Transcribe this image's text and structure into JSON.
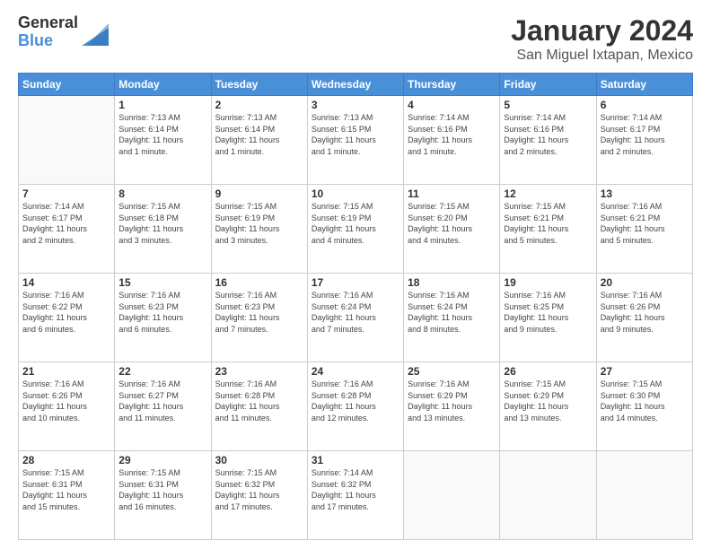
{
  "logo": {
    "general": "General",
    "blue": "Blue"
  },
  "header": {
    "title": "January 2024",
    "subtitle": "San Miguel Ixtapan, Mexico"
  },
  "weekdays": [
    "Sunday",
    "Monday",
    "Tuesday",
    "Wednesday",
    "Thursday",
    "Friday",
    "Saturday"
  ],
  "weeks": [
    [
      {
        "day": "",
        "info": ""
      },
      {
        "day": "1",
        "info": "Sunrise: 7:13 AM\nSunset: 6:14 PM\nDaylight: 11 hours\nand 1 minute."
      },
      {
        "day": "2",
        "info": "Sunrise: 7:13 AM\nSunset: 6:14 PM\nDaylight: 11 hours\nand 1 minute."
      },
      {
        "day": "3",
        "info": "Sunrise: 7:13 AM\nSunset: 6:15 PM\nDaylight: 11 hours\nand 1 minute."
      },
      {
        "day": "4",
        "info": "Sunrise: 7:14 AM\nSunset: 6:16 PM\nDaylight: 11 hours\nand 1 minute."
      },
      {
        "day": "5",
        "info": "Sunrise: 7:14 AM\nSunset: 6:16 PM\nDaylight: 11 hours\nand 2 minutes."
      },
      {
        "day": "6",
        "info": "Sunrise: 7:14 AM\nSunset: 6:17 PM\nDaylight: 11 hours\nand 2 minutes."
      }
    ],
    [
      {
        "day": "7",
        "info": "Sunrise: 7:14 AM\nSunset: 6:17 PM\nDaylight: 11 hours\nand 2 minutes."
      },
      {
        "day": "8",
        "info": "Sunrise: 7:15 AM\nSunset: 6:18 PM\nDaylight: 11 hours\nand 3 minutes."
      },
      {
        "day": "9",
        "info": "Sunrise: 7:15 AM\nSunset: 6:19 PM\nDaylight: 11 hours\nand 3 minutes."
      },
      {
        "day": "10",
        "info": "Sunrise: 7:15 AM\nSunset: 6:19 PM\nDaylight: 11 hours\nand 4 minutes."
      },
      {
        "day": "11",
        "info": "Sunrise: 7:15 AM\nSunset: 6:20 PM\nDaylight: 11 hours\nand 4 minutes."
      },
      {
        "day": "12",
        "info": "Sunrise: 7:15 AM\nSunset: 6:21 PM\nDaylight: 11 hours\nand 5 minutes."
      },
      {
        "day": "13",
        "info": "Sunrise: 7:16 AM\nSunset: 6:21 PM\nDaylight: 11 hours\nand 5 minutes."
      }
    ],
    [
      {
        "day": "14",
        "info": "Sunrise: 7:16 AM\nSunset: 6:22 PM\nDaylight: 11 hours\nand 6 minutes."
      },
      {
        "day": "15",
        "info": "Sunrise: 7:16 AM\nSunset: 6:23 PM\nDaylight: 11 hours\nand 6 minutes."
      },
      {
        "day": "16",
        "info": "Sunrise: 7:16 AM\nSunset: 6:23 PM\nDaylight: 11 hours\nand 7 minutes."
      },
      {
        "day": "17",
        "info": "Sunrise: 7:16 AM\nSunset: 6:24 PM\nDaylight: 11 hours\nand 7 minutes."
      },
      {
        "day": "18",
        "info": "Sunrise: 7:16 AM\nSunset: 6:24 PM\nDaylight: 11 hours\nand 8 minutes."
      },
      {
        "day": "19",
        "info": "Sunrise: 7:16 AM\nSunset: 6:25 PM\nDaylight: 11 hours\nand 9 minutes."
      },
      {
        "day": "20",
        "info": "Sunrise: 7:16 AM\nSunset: 6:26 PM\nDaylight: 11 hours\nand 9 minutes."
      }
    ],
    [
      {
        "day": "21",
        "info": "Sunrise: 7:16 AM\nSunset: 6:26 PM\nDaylight: 11 hours\nand 10 minutes."
      },
      {
        "day": "22",
        "info": "Sunrise: 7:16 AM\nSunset: 6:27 PM\nDaylight: 11 hours\nand 11 minutes."
      },
      {
        "day": "23",
        "info": "Sunrise: 7:16 AM\nSunset: 6:28 PM\nDaylight: 11 hours\nand 11 minutes."
      },
      {
        "day": "24",
        "info": "Sunrise: 7:16 AM\nSunset: 6:28 PM\nDaylight: 11 hours\nand 12 minutes."
      },
      {
        "day": "25",
        "info": "Sunrise: 7:16 AM\nSunset: 6:29 PM\nDaylight: 11 hours\nand 13 minutes."
      },
      {
        "day": "26",
        "info": "Sunrise: 7:15 AM\nSunset: 6:29 PM\nDaylight: 11 hours\nand 13 minutes."
      },
      {
        "day": "27",
        "info": "Sunrise: 7:15 AM\nSunset: 6:30 PM\nDaylight: 11 hours\nand 14 minutes."
      }
    ],
    [
      {
        "day": "28",
        "info": "Sunrise: 7:15 AM\nSunset: 6:31 PM\nDaylight: 11 hours\nand 15 minutes."
      },
      {
        "day": "29",
        "info": "Sunrise: 7:15 AM\nSunset: 6:31 PM\nDaylight: 11 hours\nand 16 minutes."
      },
      {
        "day": "30",
        "info": "Sunrise: 7:15 AM\nSunset: 6:32 PM\nDaylight: 11 hours\nand 17 minutes."
      },
      {
        "day": "31",
        "info": "Sunrise: 7:14 AM\nSunset: 6:32 PM\nDaylight: 11 hours\nand 17 minutes."
      },
      {
        "day": "",
        "info": ""
      },
      {
        "day": "",
        "info": ""
      },
      {
        "day": "",
        "info": ""
      }
    ]
  ]
}
